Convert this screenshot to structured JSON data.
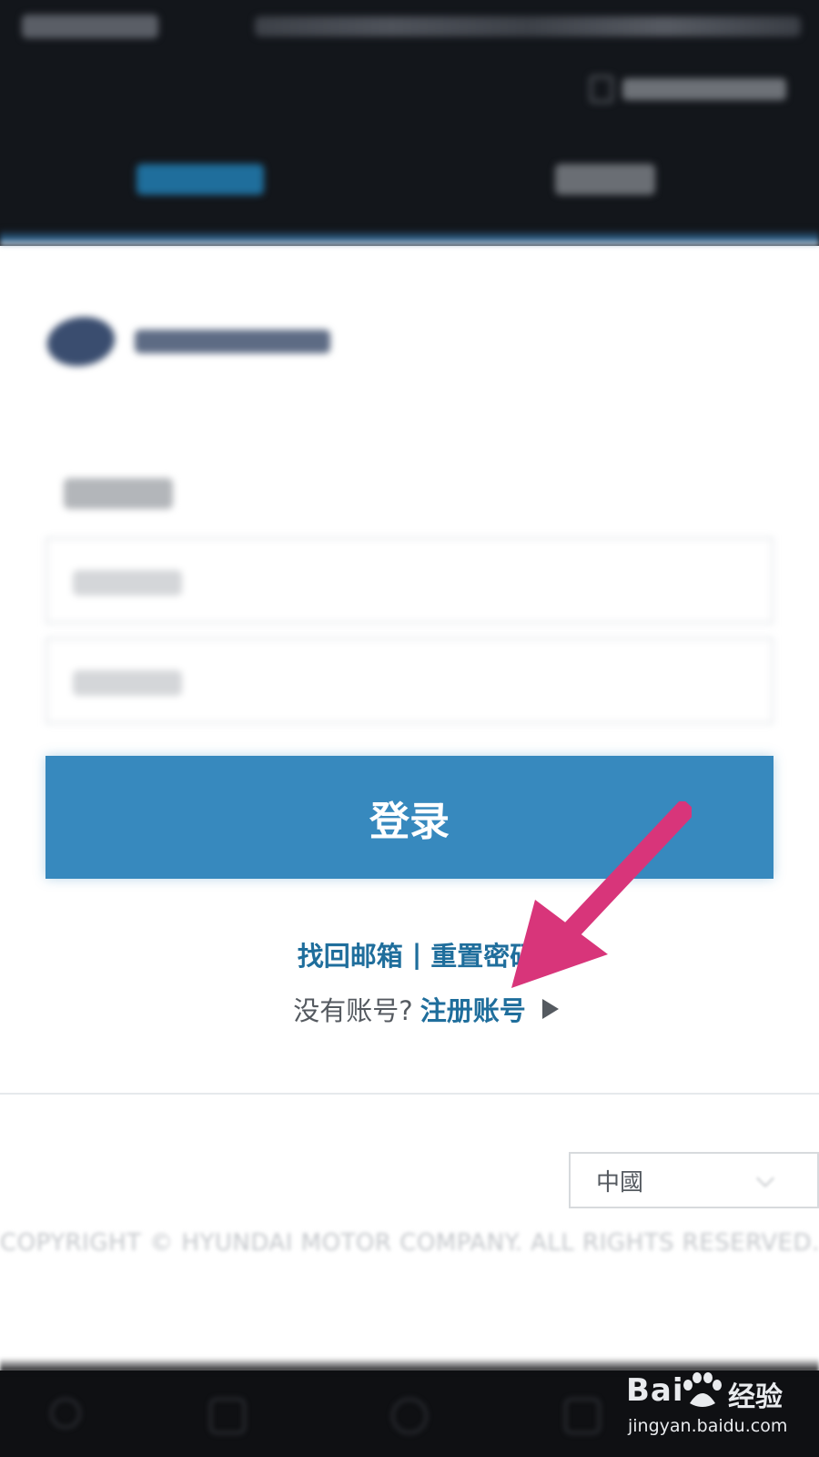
{
  "header": {
    "tabs": [
      {
        "label": "",
        "active": true
      },
      {
        "label": "",
        "active": false
      }
    ],
    "user_button_label": ""
  },
  "form": {
    "title": "",
    "email_placeholder": "",
    "password_placeholder": "",
    "login_label": "登录"
  },
  "links": {
    "find_email": "找回邮箱",
    "separator": "|",
    "reset_password": "重置密码",
    "no_account": "没有账号?",
    "register": "注册账号"
  },
  "footer": {
    "country": "中國",
    "copyright": "COPYRIGHT © HYUNDAI MOTOR COMPANY. ALL RIGHTS RESERVED."
  },
  "watermark": {
    "brand_left": "Bai",
    "brand_right": "经验",
    "url": "jingyan.baidu.com"
  },
  "colors": {
    "accent": "#3789be",
    "link": "#1f6e9c",
    "annotation_arrow": "#d8357a",
    "header_bg": "#13161b"
  }
}
